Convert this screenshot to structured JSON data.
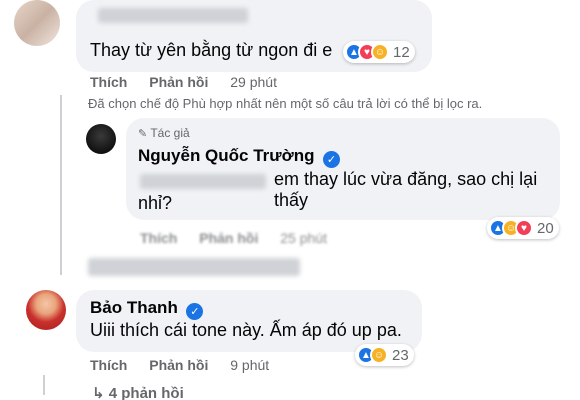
{
  "comments": [
    {
      "author": "",
      "text": "Thay từ yên bằng từ ngon đi e",
      "reaction_count": "12",
      "like_label": "Thích",
      "reply_label": "Phản hồi",
      "time": "29 phút"
    },
    {
      "author_badge": "Tác giả",
      "author": "Nguyễn Quốc Trường",
      "text_line1": "em thay lúc vừa đăng, sao chị lại thấy",
      "text_line2": "nhỉ?",
      "reaction_count": "20",
      "like_label": "Thích",
      "reply_label": "Phản hồi",
      "time": "25 phút"
    },
    {
      "author": "Bảo Thanh",
      "text": "Uiii thích cái tone này. Ấm áp đó up pa.",
      "reaction_count": "23",
      "like_label": "Thích",
      "reply_label": "Phản hồi",
      "time": "9 phút"
    }
  ],
  "filter_note": "Đã chọn chế độ Phù hợp nhất nên một số câu trả lời có thể bị lọc ra.",
  "more_replies": "4 phản hồi",
  "icons": {
    "like": "like-reaction-icon",
    "love": "love-reaction-icon",
    "haha": "haha-reaction-icon",
    "verified": "verified-badge-icon",
    "author_badge": "pencil-icon",
    "replies_arrow": "reply-arrow-icon"
  },
  "colors": {
    "like": "#1b74e4",
    "love": "#f33e58",
    "haha": "#f7b125",
    "bubble": "#f0f2f5",
    "secondary_text": "#65676b"
  }
}
